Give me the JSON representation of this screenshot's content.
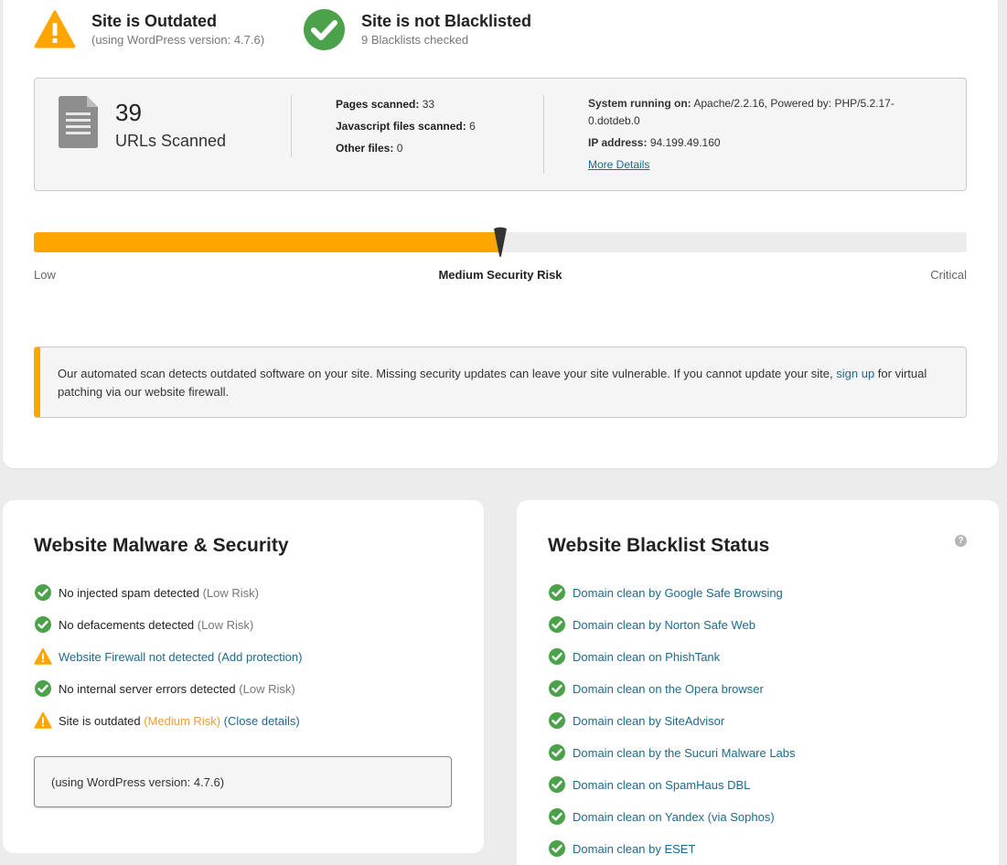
{
  "status": {
    "outdated": {
      "title": "Site is Outdated",
      "subtitle": "(using WordPress version: 4.7.6)",
      "icon": "warning-triangle-icon",
      "color": "#ffa500"
    },
    "blacklist": {
      "title": "Site is not Blacklisted",
      "subtitle": "9 Blacklists checked",
      "icon": "check-circle-icon",
      "color": "#4ca24b"
    }
  },
  "scan": {
    "url_count": "39",
    "url_label": "URLs Scanned",
    "pages_label": "Pages scanned:",
    "pages_value": "33",
    "js_label": "Javascript files scanned:",
    "js_value": "6",
    "other_label": "Other files:",
    "other_value": "0",
    "system_label": "System running on:",
    "system_value": "Apache/2.2.16, Powered by: PHP/5.2.17-",
    "system_value_2": "0.dotdeb.0",
    "ip_label": "IP address:",
    "ip_value": "94.199.49.160",
    "more_details": "More Details"
  },
  "risk": {
    "low": "Low",
    "level": "Medium Security Risk",
    "critical": "Critical",
    "fraction": 0.5
  },
  "alert": {
    "text_before": "Our automated scan detects outdated software on your site. Missing security updates can leave your site vulnerable. If you cannot update your site, ",
    "link": "sign up",
    "text_after": " for virtual patching via our website firewall."
  },
  "malware": {
    "title": "Website Malware & Security",
    "items": [
      {
        "text": "No injected spam detected",
        "suffix": "(Low Risk)"
      },
      {
        "text": "No defacements detected",
        "suffix": "(Low Risk)"
      },
      {
        "text": "Website Firewall not detected",
        "suffix": "(Add protection)"
      },
      {
        "text": "No internal server errors detected",
        "suffix": "(Low Risk)"
      },
      {
        "text": "Site is outdated",
        "suffix": "(Medium Risk)",
        "suffix2": "(Close details)"
      }
    ],
    "detail": "(using WordPress version: 4.7.6)"
  },
  "blacklist": {
    "title": "Website Blacklist Status",
    "help": "?",
    "items": [
      "Domain clean by Google Safe Browsing",
      "Domain clean by Norton Safe Web",
      "Domain clean on PhishTank",
      "Domain clean on the Opera browser",
      "Domain clean by SiteAdvisor",
      "Domain clean by the Sucuri Malware Labs",
      "Domain clean on SpamHaus DBL",
      "Domain clean on Yandex (via Sophos)",
      "Domain clean by ESET"
    ]
  }
}
